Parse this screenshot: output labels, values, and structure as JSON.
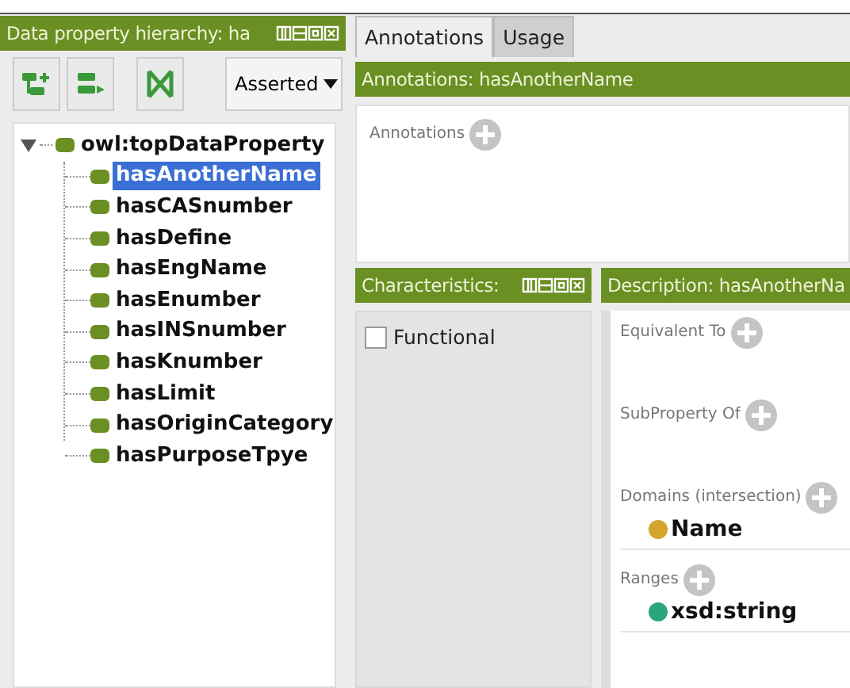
{
  "left_panel": {
    "title": "Data property hierarchy: ha",
    "view_mode": "Asserted",
    "tree": {
      "label": "owl:topDataProperty",
      "expanded": true,
      "children": [
        {
          "label": "hasAnotherName",
          "selected": true
        },
        {
          "label": "hasCASnumber",
          "selected": false
        },
        {
          "label": "hasDefine",
          "selected": false
        },
        {
          "label": "hasEngName",
          "selected": false
        },
        {
          "label": "hasEnumber",
          "selected": false
        },
        {
          "label": "hasINSnumber",
          "selected": false
        },
        {
          "label": "hasKnumber",
          "selected": false
        },
        {
          "label": "hasLimit",
          "selected": false
        },
        {
          "label": "hasOriginCategory",
          "selected": false
        },
        {
          "label": "hasPurposeTpye",
          "selected": false
        }
      ]
    }
  },
  "tabs": [
    {
      "label": "Annotations",
      "selected": true
    },
    {
      "label": "Usage",
      "selected": false
    }
  ],
  "annotations_panel": {
    "title": "Annotations: hasAnotherName",
    "section": "Annotations"
  },
  "characteristics_panel": {
    "title": "Characteristics:",
    "items": [
      {
        "label": "Functional",
        "checked": false
      }
    ]
  },
  "description_panel": {
    "title": "Description: hasAnotherNa",
    "sections": [
      {
        "label": "Equivalent To"
      },
      {
        "label": "SubProperty Of"
      },
      {
        "label": "Domains (intersection)",
        "entries": [
          {
            "label": "Name",
            "color": "#d4a42c"
          }
        ]
      },
      {
        "label": "Ranges",
        "entries": [
          {
            "label": "xsd:string",
            "color": "#27a77a"
          }
        ]
      }
    ]
  }
}
